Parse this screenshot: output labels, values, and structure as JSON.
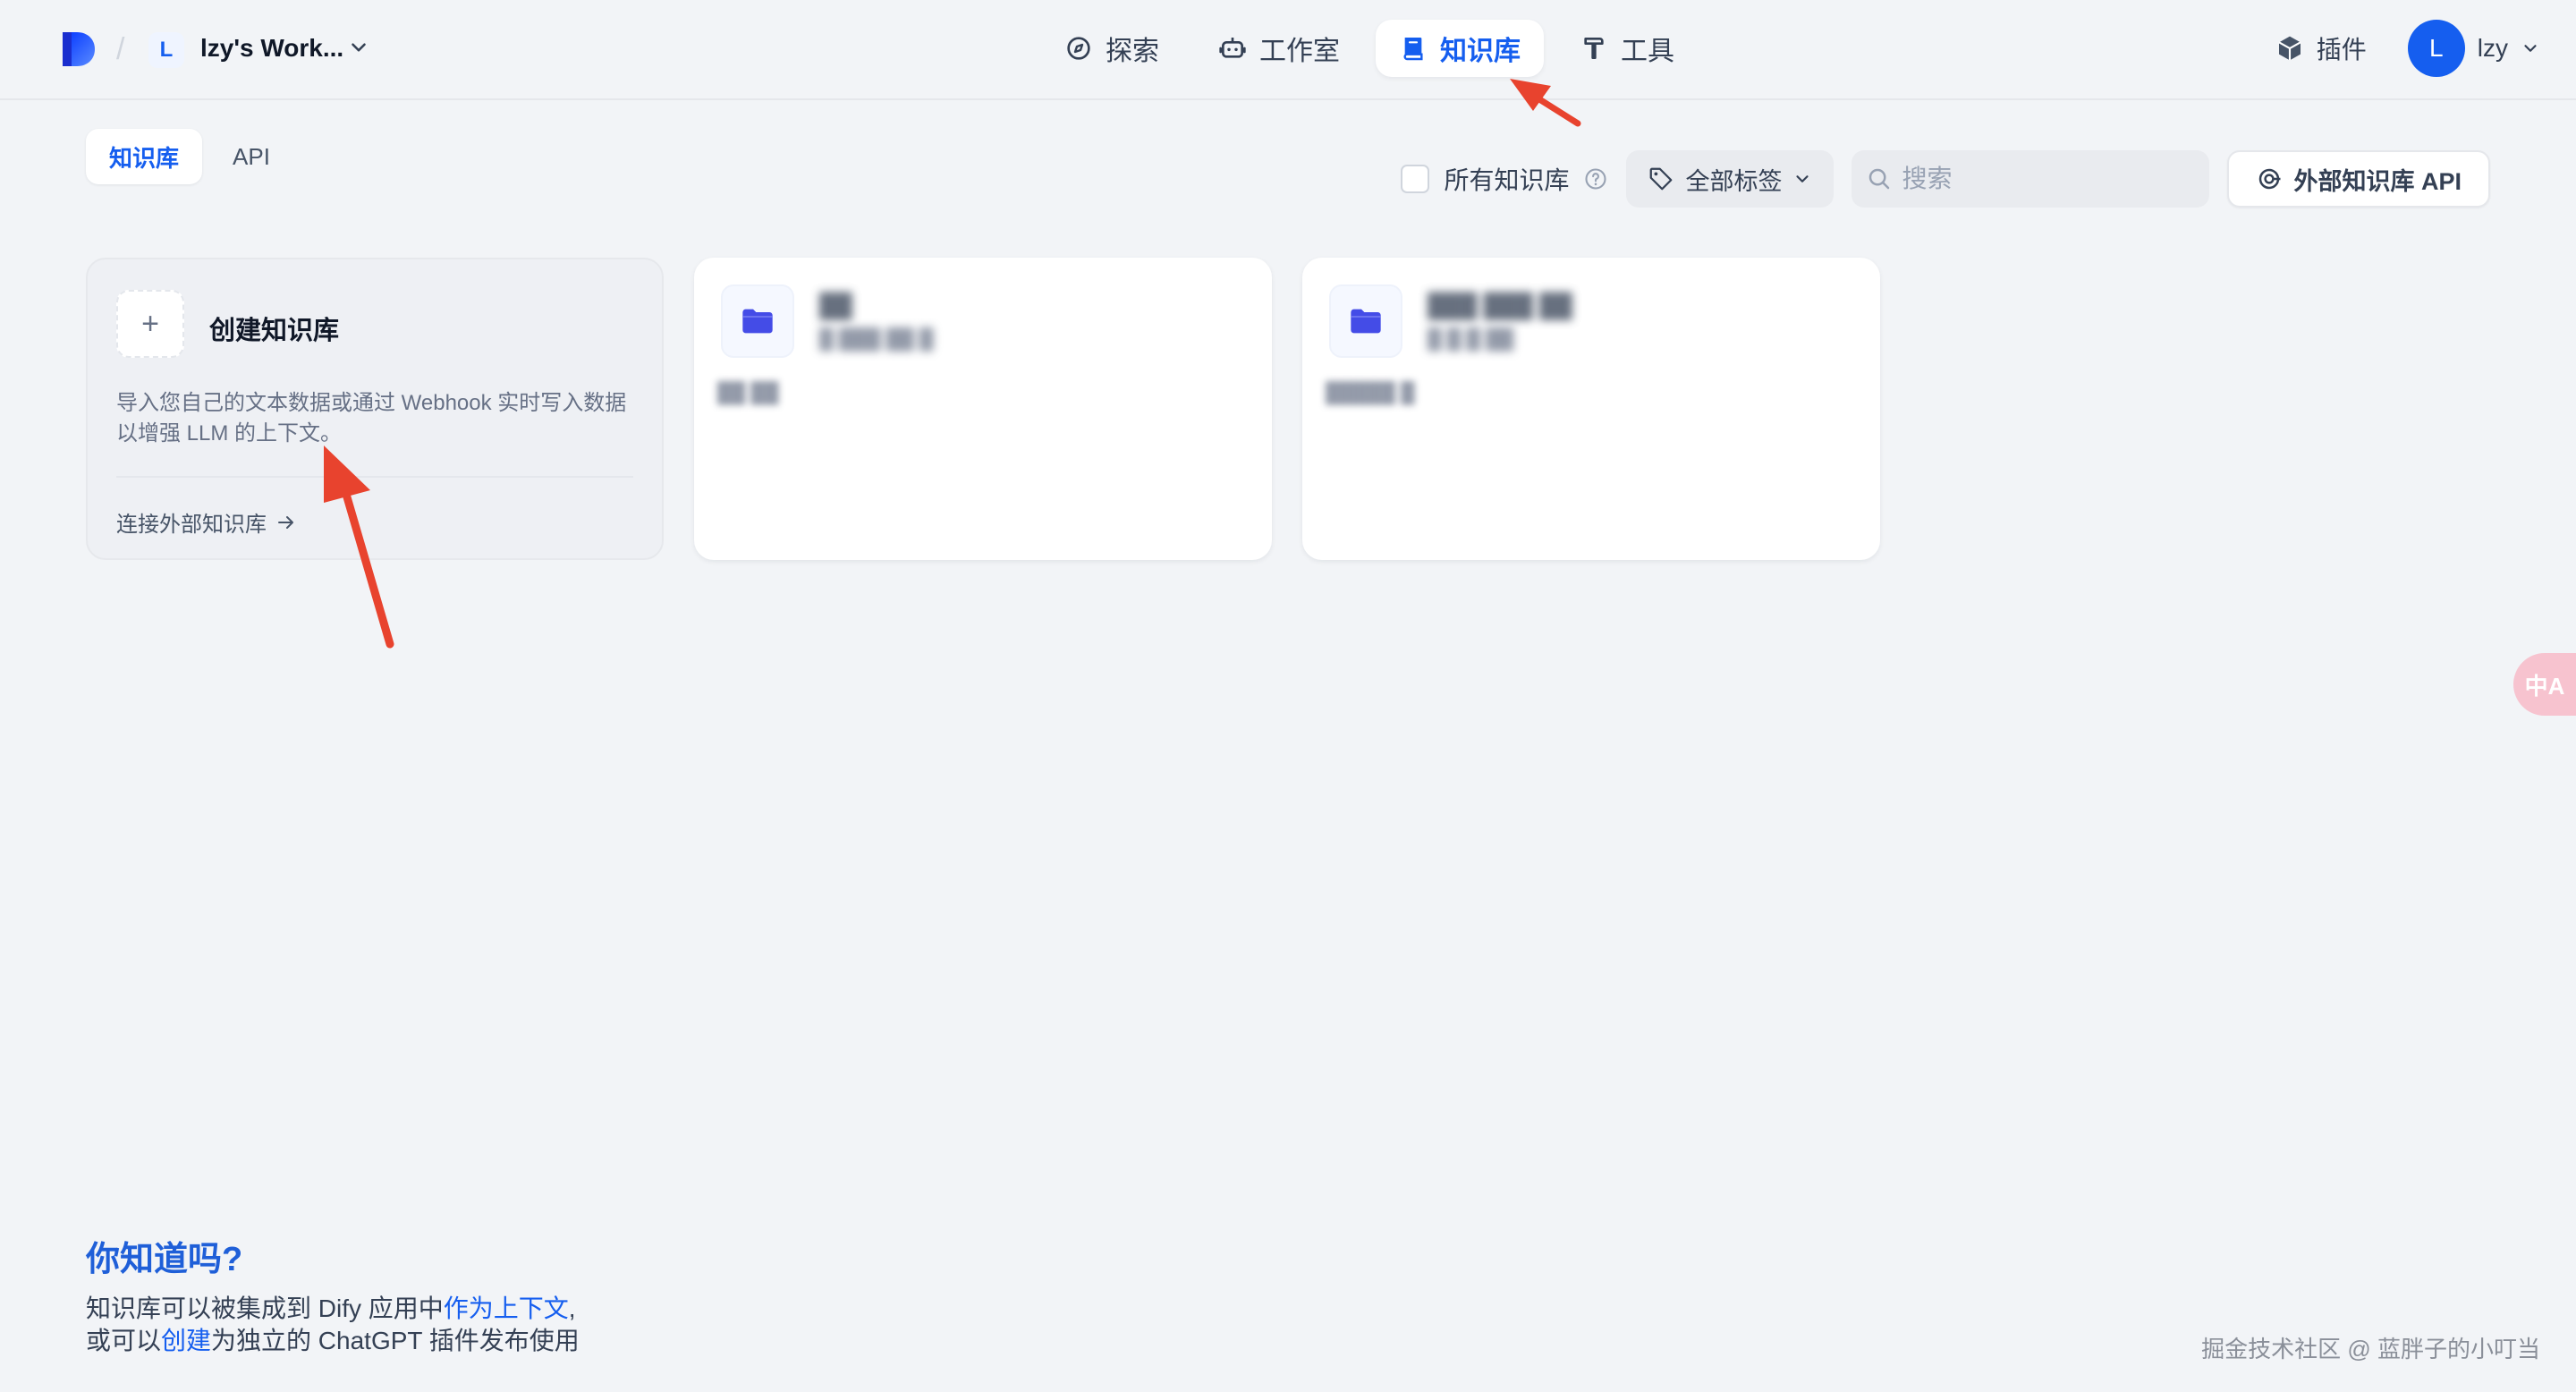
{
  "header": {
    "workspace_initial": "L",
    "workspace_name": "lzy's Work...",
    "nav": [
      {
        "label": "探索",
        "icon": "compass-icon"
      },
      {
        "label": "工作室",
        "icon": "robot-icon"
      },
      {
        "label": "知识库",
        "icon": "book-icon",
        "active": true
      },
      {
        "label": "工具",
        "icon": "hammer-icon"
      }
    ],
    "plugins_label": "插件",
    "user_initial": "L",
    "user_name": "lzy"
  },
  "toolbar": {
    "tabs": [
      {
        "label": "知识库",
        "active": true
      },
      {
        "label": "API"
      }
    ],
    "all_kb_label": "所有知识库",
    "tag_filter_label": "全部标签",
    "search_placeholder": "搜索",
    "external_api_label": "外部知识库 API"
  },
  "create_card": {
    "title": "创建知识库",
    "description": "导入您自己的文本数据或通过 Webhook 实时写入数据以增强 LLM 的上下文。",
    "link_label": "连接外部知识库"
  },
  "knowledge_bases": [
    {
      "name": "██",
      "meta": "█ ███ ██ █",
      "tag": "██ ██"
    },
    {
      "name": "███ ███ ██",
      "meta": "█ █ █ ██",
      "tag": "█████ █"
    }
  ],
  "tip": {
    "title": "你知道吗?",
    "line1_prefix": "知识库可以被集成到 Dify 应用中",
    "line1_link": "作为上下文",
    "line1_suffix": ",",
    "line2_prefix": "或可以",
    "line2_link": "创建",
    "line2_suffix": "为独立的 ChatGPT 插件发布使用"
  },
  "side_translate_label": "中A",
  "watermark": "掘金技术社区 @ 蓝胖子的小叮当",
  "colors": {
    "accent": "#155eef",
    "folder": "#444ce7",
    "annotation_arrow": "#e8432e",
    "background": "#f2f4f7"
  }
}
